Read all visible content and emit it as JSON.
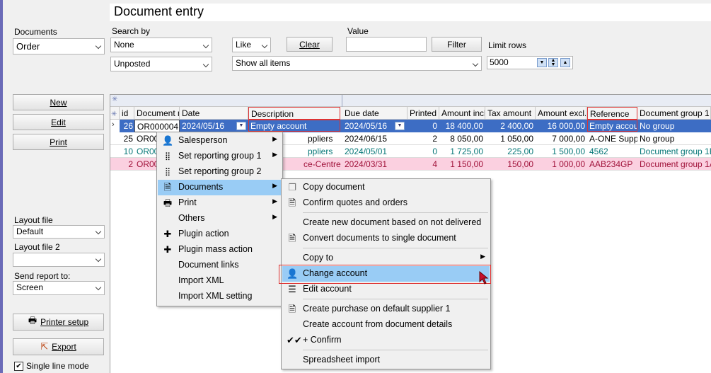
{
  "title": "Document entry",
  "filters": {
    "documents_label": "Documents",
    "documents_value": "Order",
    "search_by_label": "Search by",
    "search_by_value": "None",
    "operator_value": "Like",
    "clear_label": "Clear",
    "value_label": "Value",
    "value_text": "",
    "filter_label": "Filter",
    "limit_rows_label": "Limit rows",
    "limit_rows_value": "5000",
    "status_value": "Unposted",
    "show_value": "Show all items"
  },
  "left": {
    "new_label": "New",
    "edit_label": "Edit",
    "print_label": "Print",
    "layout_file_label": "Layout file",
    "layout_file_value": "Default",
    "layout_file2_label": "Layout file 2",
    "layout_file2_value": "",
    "send_report_label": "Send report to:",
    "send_report_value": "Screen",
    "printer_setup_label": "Printer setup",
    "export_label": "Export",
    "single_line_label": "Single line mode"
  },
  "grid": {
    "columns": [
      "id",
      "Document nu",
      "Date",
      "Description",
      "Due date",
      "Printed",
      "Amount incl.",
      "Tax amount",
      "Amount excl.",
      "Reference",
      "Document group 1"
    ],
    "rows": [
      {
        "id": "26",
        "doc": "OR000004",
        "date": "2024/05/16",
        "desc": "Empty account",
        "due": "2024/05/16",
        "printed": "0",
        "incl": "18 400,00",
        "tax": "2 400,00",
        "excl": "16 000,00",
        "ref": "Empty accoun",
        "group": "No group"
      },
      {
        "id": "25",
        "doc": "OR00",
        "date": "",
        "desc": "ppliers",
        "due": "2024/06/15",
        "printed": "2",
        "incl": "8 050,00",
        "tax": "1 050,00",
        "excl": "7 000,00",
        "ref": "A-ONE Suppl",
        "group": "No group"
      },
      {
        "id": "10",
        "doc": "OR00",
        "date": "",
        "desc": "ppliers",
        "due": "2024/05/01",
        "printed": "0",
        "incl": "1 725,00",
        "tax": "225,00",
        "excl": "1 500,00",
        "ref": "4562",
        "group": "Document group 1B"
      },
      {
        "id": "2",
        "doc": "OR00",
        "date": "",
        "desc": "ce-Centre",
        "due": "2024/03/31",
        "printed": "4",
        "incl": "1 150,00",
        "tax": "150,00",
        "excl": "1 000,00",
        "ref": "AAB234GP",
        "group": "Document group 1A"
      }
    ]
  },
  "context_menu": [
    {
      "label": "Salesperson",
      "icon": "person-icon",
      "submenu": true
    },
    {
      "label": "Set reporting group 1",
      "icon": "grid-dots-icon",
      "submenu": true
    },
    {
      "label": "Set reporting group 2",
      "icon": "grid-dots-icon",
      "submenu": false
    },
    {
      "label": "Documents",
      "icon": "document-icon",
      "submenu": true
    },
    {
      "label": "Print",
      "icon": "printer-icon",
      "submenu": true
    },
    {
      "label": "Others",
      "icon": "",
      "submenu": true
    },
    {
      "label": "Plugin action",
      "icon": "puzzle-icon",
      "submenu": false
    },
    {
      "label": "Plugin mass action",
      "icon": "puzzle-icon",
      "submenu": false
    },
    {
      "label": "Document links",
      "icon": "",
      "submenu": false
    },
    {
      "label": "Import XML",
      "icon": "",
      "submenu": false
    },
    {
      "label": "Import XML setting",
      "icon": "",
      "submenu": false
    }
  ],
  "sub_menu": [
    {
      "label": "Copy document",
      "icon": "copy-icon"
    },
    {
      "label": "Confirm quotes and orders",
      "icon": "document-icon"
    },
    {
      "label": "Create new document based on not delivered",
      "icon": ""
    },
    {
      "label": "Convert documents to single document",
      "icon": "document-icon"
    },
    {
      "label": "Copy to",
      "icon": "",
      "submenu": true
    },
    {
      "label": "Change account",
      "icon": "person-icon"
    },
    {
      "label": "Edit account",
      "icon": "list-icon"
    },
    {
      "label": "Create purchase on default supplier 1",
      "icon": "document-icon"
    },
    {
      "label": "Create account from document details",
      "icon": ""
    },
    {
      "label": "+ Confirm",
      "icon": "double-check-icon"
    },
    {
      "label": "Spreadsheet import",
      "icon": ""
    }
  ]
}
